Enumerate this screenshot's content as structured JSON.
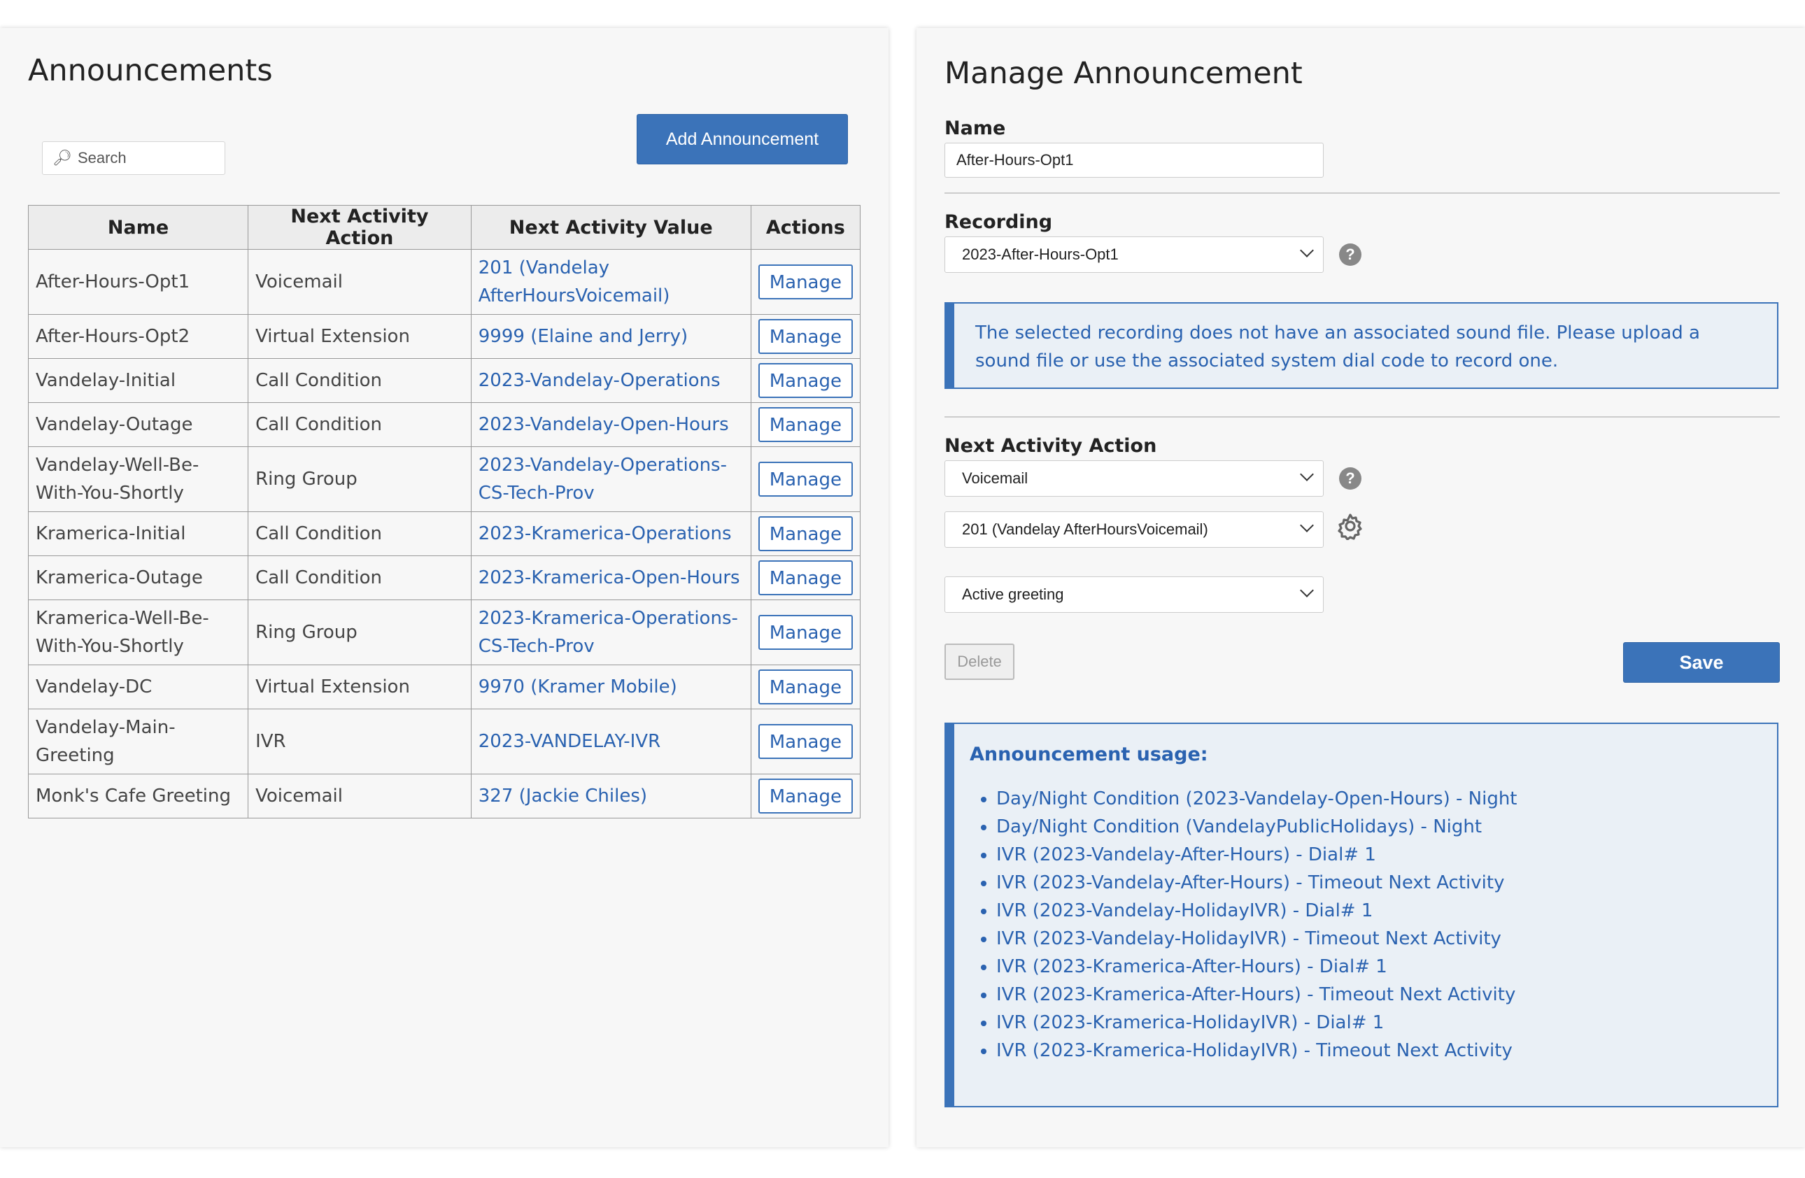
{
  "left": {
    "title": "Announcements",
    "search_placeholder": "Search",
    "add_button": "Add Announcement",
    "columns": [
      "Name",
      "Next Activity Action",
      "Next Activity Value",
      "Actions"
    ],
    "rows": [
      {
        "name": "After-Hours-Opt1",
        "action": "Voicemail",
        "value": "201 (Vandelay AfterHoursVoicemail)",
        "button": "Manage"
      },
      {
        "name": "After-Hours-Opt2",
        "action": "Virtual Extension",
        "value": "9999 (Elaine and Jerry)",
        "button": "Manage"
      },
      {
        "name": "Vandelay-Initial",
        "action": "Call Condition",
        "value": "2023-Vandelay-Operations",
        "button": "Manage"
      },
      {
        "name": "Vandelay-Outage",
        "action": "Call Condition",
        "value": "2023-Vandelay-Open-Hours",
        "button": "Manage"
      },
      {
        "name": "Vandelay-Well-Be-With-You-Shortly",
        "action": "Ring Group",
        "value": "2023-Vandelay-Operations-CS-Tech-Prov",
        "button": "Manage"
      },
      {
        "name": "Kramerica-Initial",
        "action": "Call Condition",
        "value": "2023-Kramerica-Operations",
        "button": "Manage"
      },
      {
        "name": "Kramerica-Outage",
        "action": "Call Condition",
        "value": "2023-Kramerica-Open-Hours",
        "button": "Manage"
      },
      {
        "name": "Kramerica-Well-Be-With-You-Shortly",
        "action": "Ring Group",
        "value": "2023-Kramerica-Operations-CS-Tech-Prov",
        "button": "Manage"
      },
      {
        "name": "Vandelay-DC",
        "action": "Virtual Extension",
        "value": "9970 (Kramer Mobile)",
        "button": "Manage"
      },
      {
        "name": "Vandelay-Main-Greeting",
        "action": "IVR",
        "value": "2023-VANDELAY-IVR",
        "button": "Manage"
      },
      {
        "name": "Monk's Cafe Greeting",
        "action": "Voicemail",
        "value": "327 (Jackie Chiles)",
        "button": "Manage"
      }
    ]
  },
  "right": {
    "title": "Manage Announcement",
    "name_label": "Name",
    "name_value": "After-Hours-Opt1",
    "recording_label": "Recording",
    "recording_value": "2023-After-Hours-Opt1",
    "warning": "The selected recording does not have an associated sound file. Please upload a sound file or use the associated system dial code to record one.",
    "next_action_label": "Next Activity Action",
    "next_action_value": "Voicemail",
    "next_target_value": "201 (Vandelay AfterHoursVoicemail)",
    "greeting_value": "Active greeting",
    "delete_button": "Delete",
    "save_button": "Save",
    "usage_title": "Announcement usage:",
    "usage_items": [
      "Day/Night Condition (2023-Vandelay-Open-Hours) - Night",
      "Day/Night Condition (VandelayPublicHolidays) - Night",
      "IVR (2023-Vandelay-After-Hours) - Dial# 1",
      "IVR (2023-Vandelay-After-Hours) - Timeout Next Activity",
      "IVR (2023-Vandelay-HolidayIVR) - Dial# 1",
      "IVR (2023-Vandelay-HolidayIVR) - Timeout Next Activity",
      "IVR (2023-Kramerica-After-Hours) - Dial# 1",
      "IVR (2023-Kramerica-After-Hours) - Timeout Next Activity",
      "IVR (2023-Kramerica-HolidayIVR) - Dial# 1",
      "IVR (2023-Kramerica-HolidayIVR) - Timeout Next Activity"
    ]
  },
  "colors": {
    "accent": "#3b73b9",
    "link": "#2a62b0",
    "panel_bg": "#f7f7f7"
  },
  "icons": {
    "search": "magnifier-icon",
    "help": "question-circle-icon",
    "settings": "gear-icon"
  }
}
